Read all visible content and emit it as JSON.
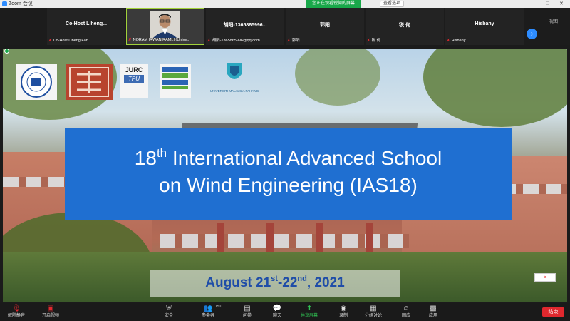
{
  "window": {
    "app_title": "Zoom 会议",
    "share_banner": "您正在观看锐何的屏幕",
    "view_options": "查看选项",
    "controls": [
      "–",
      "□",
      "✕"
    ]
  },
  "participants": [
    {
      "name": "Co-Host  Liheng...",
      "label": "Co-Host Liheng Fan"
    },
    {
      "name": "",
      "label": "NORAM IRWAN RAMLI (Unive..."
    },
    {
      "name": "胡阳-1365865996...",
      "label": "胡阳-1365865996@qq.com"
    },
    {
      "name": "郭阳",
      "label": "郭阳"
    },
    {
      "name": "锐 何",
      "label": "锐 何"
    },
    {
      "name": "Hisbany",
      "label": "Hisbany"
    }
  ],
  "strip": {
    "view_label": "视图",
    "next_icon": "chevron-right-icon"
  },
  "slide": {
    "title_num": "18",
    "title_sup": "th",
    "title_rest": " International Advanced School",
    "title_line2": "on Wind Engineering (IAS18)",
    "date_a": "August 21",
    "date_sup1": "st",
    "date_b": "-22",
    "date_sup2": "nd",
    "date_c": ", 2021",
    "logo_jurc": "JURC",
    "logo_tpu": "TPU",
    "logo_ump": "UNIVERSITI MALAYSIA PAHANG",
    "badge": "S"
  },
  "toolbar": {
    "items": [
      {
        "icon": "mic-muted-icon",
        "glyph": "🎙",
        "label": "解除静音"
      },
      {
        "icon": "video-off-icon",
        "glyph": "▣",
        "label": "开启视频"
      },
      {
        "icon": "security-icon",
        "glyph": "⛨",
        "label": "安全"
      },
      {
        "icon": "participants-icon",
        "glyph": "👥",
        "label": "参会者"
      },
      {
        "icon": "qa-icon",
        "glyph": "▤",
        "label": "问卷"
      },
      {
        "icon": "chat-icon",
        "glyph": "💬",
        "label": "聊天"
      },
      {
        "icon": "share-screen-icon",
        "glyph": "⬆",
        "label": "共享屏幕"
      },
      {
        "icon": "record-icon",
        "glyph": "◉",
        "label": "录制"
      },
      {
        "icon": "breakout-icon",
        "glyph": "▦",
        "label": "分组讨论"
      },
      {
        "icon": "reactions-icon",
        "glyph": "☺",
        "label": "回应"
      },
      {
        "icon": "apps-icon",
        "glyph": "▩",
        "label": "应用"
      }
    ],
    "participant_count": "150",
    "end_label": "结束"
  },
  "colors": {
    "accent": "#2d8cff",
    "title_box": "#1f6fd1",
    "share_green": "#19a84a",
    "end_red": "#e0282e"
  }
}
